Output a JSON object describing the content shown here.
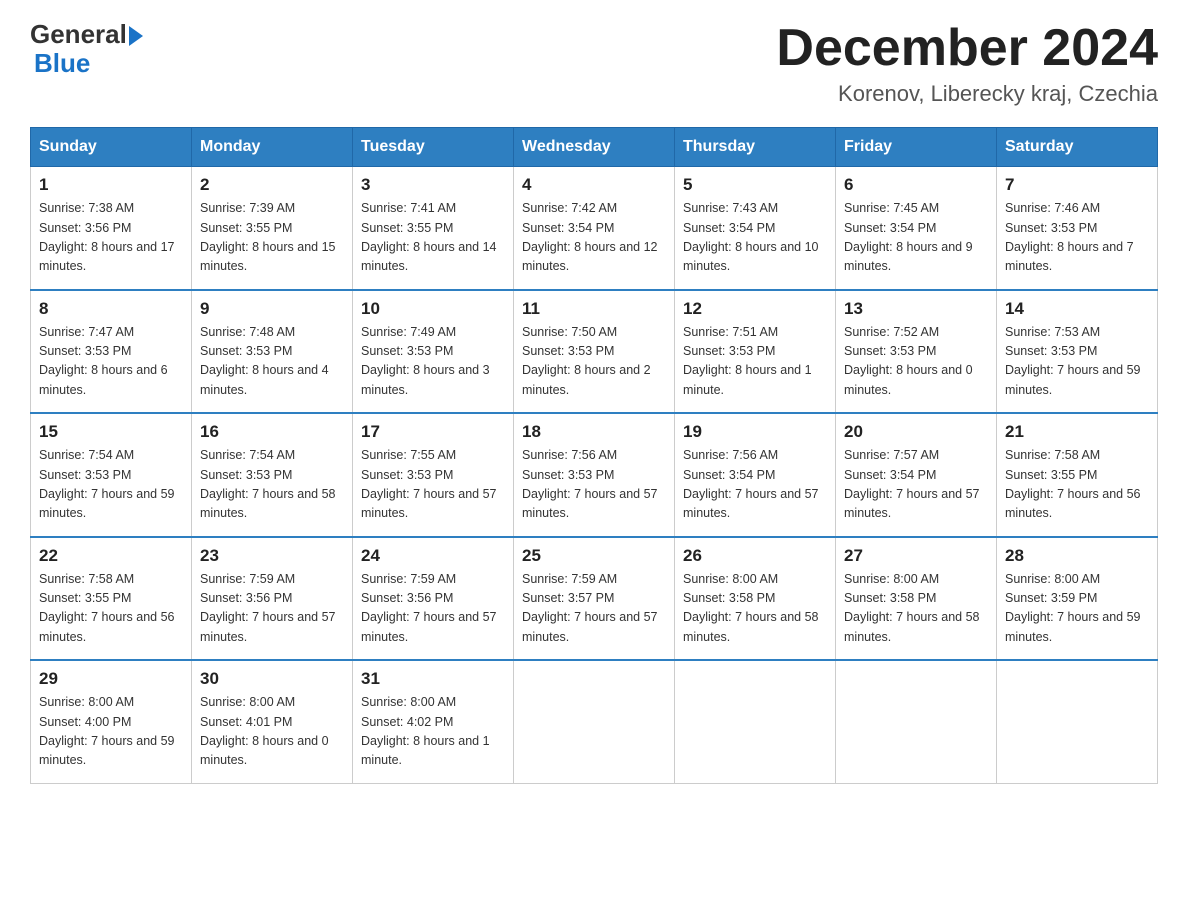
{
  "header": {
    "logo_general": "General",
    "logo_blue": "Blue",
    "month": "December 2024",
    "location": "Korenov, Liberecky kraj, Czechia"
  },
  "days_of_week": [
    "Sunday",
    "Monday",
    "Tuesday",
    "Wednesday",
    "Thursday",
    "Friday",
    "Saturday"
  ],
  "weeks": [
    [
      {
        "num": "1",
        "sunrise": "7:38 AM",
        "sunset": "3:56 PM",
        "daylight": "8 hours and 17 minutes."
      },
      {
        "num": "2",
        "sunrise": "7:39 AM",
        "sunset": "3:55 PM",
        "daylight": "8 hours and 15 minutes."
      },
      {
        "num": "3",
        "sunrise": "7:41 AM",
        "sunset": "3:55 PM",
        "daylight": "8 hours and 14 minutes."
      },
      {
        "num": "4",
        "sunrise": "7:42 AM",
        "sunset": "3:54 PM",
        "daylight": "8 hours and 12 minutes."
      },
      {
        "num": "5",
        "sunrise": "7:43 AM",
        "sunset": "3:54 PM",
        "daylight": "8 hours and 10 minutes."
      },
      {
        "num": "6",
        "sunrise": "7:45 AM",
        "sunset": "3:54 PM",
        "daylight": "8 hours and 9 minutes."
      },
      {
        "num": "7",
        "sunrise": "7:46 AM",
        "sunset": "3:53 PM",
        "daylight": "8 hours and 7 minutes."
      }
    ],
    [
      {
        "num": "8",
        "sunrise": "7:47 AM",
        "sunset": "3:53 PM",
        "daylight": "8 hours and 6 minutes."
      },
      {
        "num": "9",
        "sunrise": "7:48 AM",
        "sunset": "3:53 PM",
        "daylight": "8 hours and 4 minutes."
      },
      {
        "num": "10",
        "sunrise": "7:49 AM",
        "sunset": "3:53 PM",
        "daylight": "8 hours and 3 minutes."
      },
      {
        "num": "11",
        "sunrise": "7:50 AM",
        "sunset": "3:53 PM",
        "daylight": "8 hours and 2 minutes."
      },
      {
        "num": "12",
        "sunrise": "7:51 AM",
        "sunset": "3:53 PM",
        "daylight": "8 hours and 1 minute."
      },
      {
        "num": "13",
        "sunrise": "7:52 AM",
        "sunset": "3:53 PM",
        "daylight": "8 hours and 0 minutes."
      },
      {
        "num": "14",
        "sunrise": "7:53 AM",
        "sunset": "3:53 PM",
        "daylight": "7 hours and 59 minutes."
      }
    ],
    [
      {
        "num": "15",
        "sunrise": "7:54 AM",
        "sunset": "3:53 PM",
        "daylight": "7 hours and 59 minutes."
      },
      {
        "num": "16",
        "sunrise": "7:54 AM",
        "sunset": "3:53 PM",
        "daylight": "7 hours and 58 minutes."
      },
      {
        "num": "17",
        "sunrise": "7:55 AM",
        "sunset": "3:53 PM",
        "daylight": "7 hours and 57 minutes."
      },
      {
        "num": "18",
        "sunrise": "7:56 AM",
        "sunset": "3:53 PM",
        "daylight": "7 hours and 57 minutes."
      },
      {
        "num": "19",
        "sunrise": "7:56 AM",
        "sunset": "3:54 PM",
        "daylight": "7 hours and 57 minutes."
      },
      {
        "num": "20",
        "sunrise": "7:57 AM",
        "sunset": "3:54 PM",
        "daylight": "7 hours and 57 minutes."
      },
      {
        "num": "21",
        "sunrise": "7:58 AM",
        "sunset": "3:55 PM",
        "daylight": "7 hours and 56 minutes."
      }
    ],
    [
      {
        "num": "22",
        "sunrise": "7:58 AM",
        "sunset": "3:55 PM",
        "daylight": "7 hours and 56 minutes."
      },
      {
        "num": "23",
        "sunrise": "7:59 AM",
        "sunset": "3:56 PM",
        "daylight": "7 hours and 57 minutes."
      },
      {
        "num": "24",
        "sunrise": "7:59 AM",
        "sunset": "3:56 PM",
        "daylight": "7 hours and 57 minutes."
      },
      {
        "num": "25",
        "sunrise": "7:59 AM",
        "sunset": "3:57 PM",
        "daylight": "7 hours and 57 minutes."
      },
      {
        "num": "26",
        "sunrise": "8:00 AM",
        "sunset": "3:58 PM",
        "daylight": "7 hours and 58 minutes."
      },
      {
        "num": "27",
        "sunrise": "8:00 AM",
        "sunset": "3:58 PM",
        "daylight": "7 hours and 58 minutes."
      },
      {
        "num": "28",
        "sunrise": "8:00 AM",
        "sunset": "3:59 PM",
        "daylight": "7 hours and 59 minutes."
      }
    ],
    [
      {
        "num": "29",
        "sunrise": "8:00 AM",
        "sunset": "4:00 PM",
        "daylight": "7 hours and 59 minutes."
      },
      {
        "num": "30",
        "sunrise": "8:00 AM",
        "sunset": "4:01 PM",
        "daylight": "8 hours and 0 minutes."
      },
      {
        "num": "31",
        "sunrise": "8:00 AM",
        "sunset": "4:02 PM",
        "daylight": "8 hours and 1 minute."
      },
      null,
      null,
      null,
      null
    ]
  ]
}
